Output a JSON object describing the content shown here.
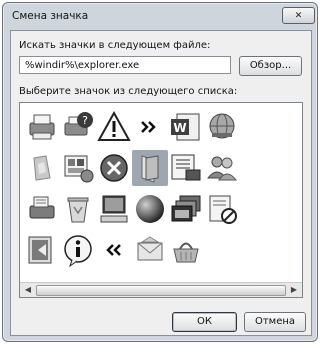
{
  "window": {
    "title": "Смена значка",
    "close_label": "✕"
  },
  "search": {
    "label": "Искать значки в следующем файле:",
    "value": "%windir%\\explorer.exe",
    "browse_label": "Обзор..."
  },
  "icons": {
    "label": "Выберите значок из следующего списка:"
  },
  "buttons": {
    "ok": "ОК",
    "cancel": "Отмена"
  }
}
